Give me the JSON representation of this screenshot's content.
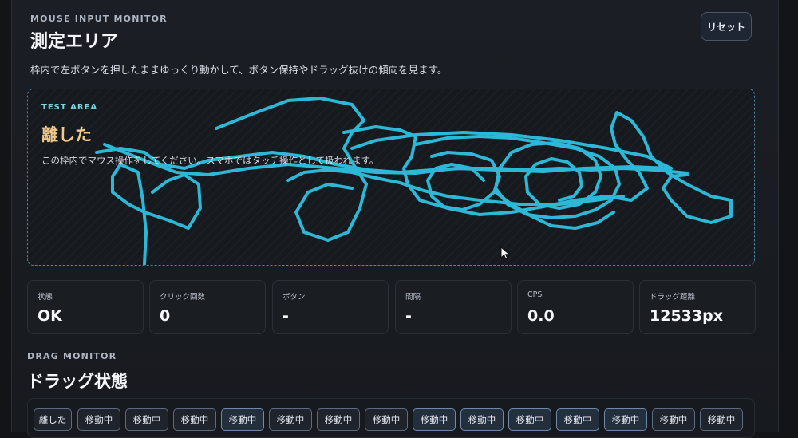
{
  "header": {
    "overline": "MOUSE INPUT MONITOR",
    "title": "測定エリア",
    "description": "枠内で左ボタンを押したままゆっくり動かして、ボタン保持やドラッグ抜けの傾向を見ます。",
    "reset_label": "リセット"
  },
  "test_area": {
    "label": "TEST AREA",
    "state": "離した",
    "hint": "この枠内でマウス操作をしてください。スマホではタッチ操作として扱われます。",
    "trail_color": "#2ec6e6",
    "cursor_icon": "pointer-cursor-icon"
  },
  "stats": [
    {
      "label": "状態",
      "value": "OK"
    },
    {
      "label": "クリック回数",
      "value": "0"
    },
    {
      "label": "ボタン",
      "value": "-"
    },
    {
      "label": "間隔",
      "value": "-"
    },
    {
      "label": "CPS",
      "value": "0.0"
    },
    {
      "label": "ドラッグ距離",
      "value": "12533px"
    }
  ],
  "drag_monitor": {
    "overline": "DRAG MONITOR",
    "title": "ドラッグ状態",
    "events": [
      "離した",
      "移動中",
      "移動中",
      "移動中",
      "移動中",
      "移動中",
      "移動中",
      "移動中",
      "移動中",
      "移動中",
      "移動中",
      "移動中",
      "移動中",
      "移動中",
      "移動中"
    ]
  },
  "colors": {
    "background": "#121418",
    "accent": "#2ec6e6",
    "state_text": "#f1c98a"
  }
}
